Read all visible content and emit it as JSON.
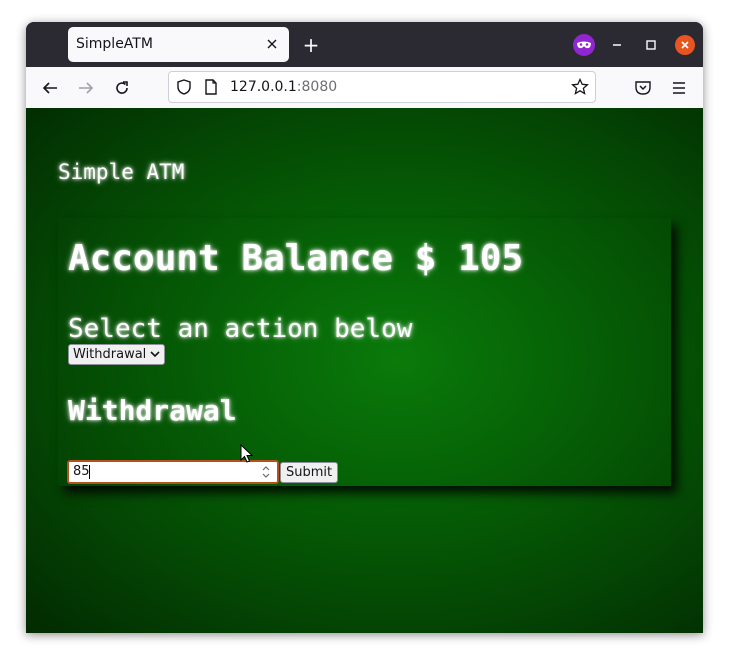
{
  "browser": {
    "tab_title": "SimpleATM",
    "url_host": "127.0.0.1",
    "url_port": ":8080",
    "new_tab_label": "+"
  },
  "page": {
    "site_title": "Simple ATM",
    "balance_heading": "Account Balance $ 105",
    "select_label": "Select an action below",
    "action_select": {
      "selected": "Withdrawal"
    },
    "section_heading": "Withdrawal",
    "amount_input": {
      "value": "85"
    },
    "submit_label": "Submit"
  },
  "colors": {
    "accent": "#8f26cf",
    "window_close": "#e95420",
    "background_green": "#066406",
    "input_focus_border": "#b4521e"
  },
  "icons": [
    "private-browsing-icon",
    "minimize-icon",
    "maximize-icon",
    "close-icon",
    "back-arrow-icon",
    "forward-arrow-icon",
    "reload-icon",
    "shield-icon",
    "page-icon",
    "star-icon",
    "pocket-icon",
    "menu-icon",
    "chevron-down-icon",
    "spinner-icon",
    "mouse-cursor-icon"
  ]
}
